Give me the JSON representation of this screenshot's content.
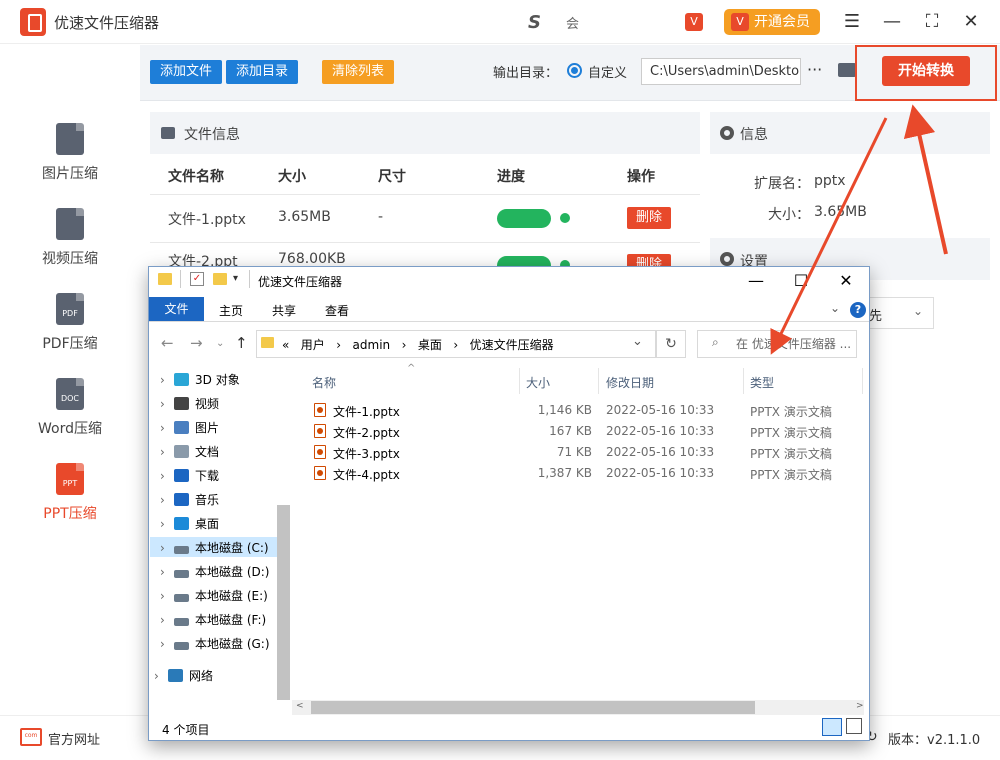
{
  "app": {
    "title": "优速文件压缩器",
    "user_logo": "S",
    "user_name": "会",
    "vip_label": "开通会员",
    "vip_icon": "V"
  },
  "window_controls": {
    "menu": "☰",
    "minimize": "—",
    "maximize": "⛶",
    "close": "✕"
  },
  "sidebar": {
    "items": [
      {
        "label": "图片压缩",
        "icon": "image-file-icon"
      },
      {
        "label": "视频压缩",
        "icon": "video-file-icon"
      },
      {
        "label": "PDF压缩",
        "icon": "pdf-file-icon",
        "badge": "PDF"
      },
      {
        "label": "Word压缩",
        "icon": "doc-file-icon",
        "badge": "DOC"
      },
      {
        "label": "PPT压缩",
        "icon": "ppt-file-icon",
        "badge": "PPT",
        "active": true
      }
    ]
  },
  "toolbar": {
    "add_file": "添加文件",
    "add_dir": "添加目录",
    "clear_list": "清除列表",
    "output_label": "输出目录：",
    "output_option": "自定义",
    "output_path": "C:\\Users\\admin\\Deskto",
    "more": "···",
    "start": "开始转换"
  },
  "file_panel": {
    "title": "文件信息",
    "columns": [
      "文件名称",
      "大小",
      "尺寸",
      "进度",
      "操作"
    ],
    "rows": [
      {
        "name": "文件-1.pptx",
        "size": "3.65MB",
        "dims": "-",
        "progress": 1.0,
        "action": "删除"
      },
      {
        "name": "文件-2.ppt",
        "size": "768.00KB",
        "dims": "",
        "progress": 1.0,
        "action": "删除"
      }
    ]
  },
  "info_panel": {
    "title": "信息",
    "ext_label": "扩展名：",
    "ext_value": "pptx",
    "size_label": "大小：",
    "size_value": "3.65MB",
    "settings_title": "设置",
    "setting_partial": "先"
  },
  "footer": {
    "website": "官方网址",
    "website_icon": "com",
    "version_label": "版本：",
    "version_value": "v2.1.1.0"
  },
  "explorer": {
    "title": "优速文件压缩器",
    "ribbon": {
      "file": "文件",
      "tabs": [
        "主页",
        "共享",
        "查看"
      ]
    },
    "address": [
      "«",
      "用户",
      "›",
      "admin",
      "›",
      "桌面",
      "›",
      "优速文件压缩器"
    ],
    "search_placeholder": "在 优速文件压缩器 ...",
    "tree": [
      {
        "label": "3D 对象",
        "icon_color": "#2aa6d6"
      },
      {
        "label": "视频",
        "icon_color": "#444"
      },
      {
        "label": "图片",
        "icon_color": "#4a7fc0"
      },
      {
        "label": "文档",
        "icon_color": "#8a9aaa"
      },
      {
        "label": "下载",
        "icon_color": "#1c66c2"
      },
      {
        "label": "音乐",
        "icon_color": "#1c66c2"
      },
      {
        "label": "桌面",
        "icon_color": "#1c8ad8"
      },
      {
        "label": "本地磁盘 (C:)",
        "icon_color": "#6a7a8a",
        "selected": true
      },
      {
        "label": "本地磁盘 (D:)",
        "icon_color": "#6a7a8a"
      },
      {
        "label": "本地磁盘 (E:)",
        "icon_color": "#6a7a8a"
      },
      {
        "label": "本地磁盘 (F:)",
        "icon_color": "#6a7a8a"
      },
      {
        "label": "本地磁盘 (G:)",
        "icon_color": "#6a7a8a"
      },
      {
        "label": "网络",
        "icon_color": "#2a7ab8"
      }
    ],
    "columns": [
      "名称",
      "大小",
      "修改日期",
      "类型"
    ],
    "files": [
      {
        "name": "文件-1.pptx",
        "size": "1,146 KB",
        "date": "2022-05-16 10:33",
        "type": "PPTX 演示文稿"
      },
      {
        "name": "文件-2.pptx",
        "size": "167 KB",
        "date": "2022-05-16 10:33",
        "type": "PPTX 演示文稿"
      },
      {
        "name": "文件-3.pptx",
        "size": "71 KB",
        "date": "2022-05-16 10:33",
        "type": "PPTX 演示文稿"
      },
      {
        "name": "文件-4.pptx",
        "size": "1,387 KB",
        "date": "2022-05-16 10:33",
        "type": "PPTX 演示文稿"
      }
    ],
    "status": "4 个项目"
  },
  "colors": {
    "accent": "#e8492b",
    "blue": "#1e7ed8",
    "orange": "#f59e22",
    "green": "#23b45e"
  }
}
